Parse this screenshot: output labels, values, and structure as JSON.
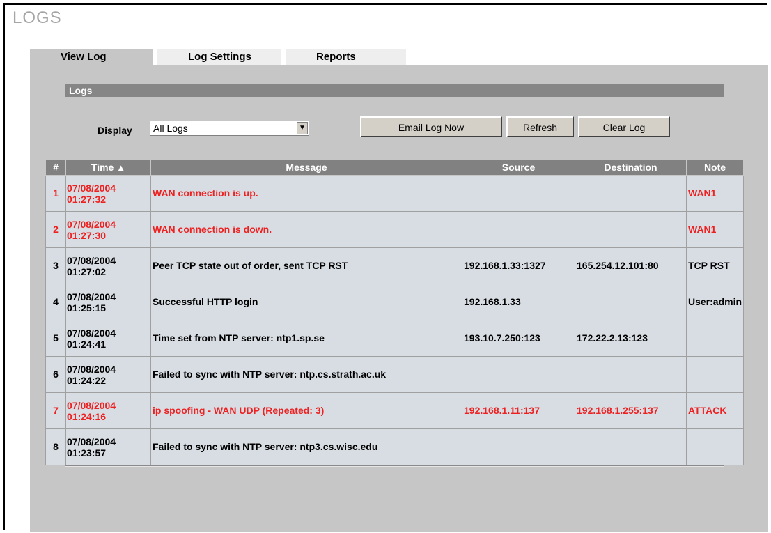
{
  "page_title": "LOGS",
  "tabs": [
    {
      "label": "View Log",
      "active": true
    },
    {
      "label": "Log Settings",
      "active": false
    },
    {
      "label": "Reports",
      "active": false
    }
  ],
  "section_title": "Logs",
  "display": {
    "label": "Display",
    "selected": "All Logs"
  },
  "buttons": {
    "email": "Email Log Now",
    "refresh": "Refresh",
    "clear": "Clear Log"
  },
  "table": {
    "columns": [
      "#",
      "Time",
      "Message",
      "Source",
      "Destination",
      "Note"
    ],
    "sort_arrow": "▲",
    "rows": [
      {
        "num": "1",
        "date": "07/08/2004",
        "time": "01:27:32",
        "message": "WAN connection is up.",
        "source": "",
        "destination": "",
        "note": "WAN1",
        "highlight": true
      },
      {
        "num": "2",
        "date": "07/08/2004",
        "time": "01:27:30",
        "message": "WAN connection is down.",
        "source": "",
        "destination": "",
        "note": "WAN1",
        "highlight": true
      },
      {
        "num": "3",
        "date": "07/08/2004",
        "time": "01:27:02",
        "message": "Peer TCP state out of order, sent TCP RST",
        "source": "192.168.1.33:1327",
        "destination": "165.254.12.101:80",
        "note": "TCP RST",
        "highlight": false
      },
      {
        "num": "4",
        "date": "07/08/2004",
        "time": "01:25:15",
        "message": "Successful HTTP login",
        "source": "192.168.1.33",
        "destination": "",
        "note": "User:admin",
        "highlight": false
      },
      {
        "num": "5",
        "date": "07/08/2004",
        "time": "01:24:41",
        "message": "Time set from NTP server: ntp1.sp.se",
        "source": "193.10.7.250:123",
        "destination": "172.22.2.13:123",
        "note": "",
        "highlight": false
      },
      {
        "num": "6",
        "date": "07/08/2004",
        "time": "01:24:22",
        "message": "Failed to sync with NTP server: ntp.cs.strath.ac.uk",
        "source": "",
        "destination": "",
        "note": "",
        "highlight": false
      },
      {
        "num": "7",
        "date": "07/08/2004",
        "time": "01:24:16",
        "message": "ip spoofing - WAN UDP (Repeated: 3)",
        "source": "192.168.1.11:137",
        "destination": "192.168.1.255:137",
        "note": "ATTACK",
        "highlight": true
      },
      {
        "num": "8",
        "date": "07/08/2004",
        "time": "01:23:57",
        "message": "Failed to sync with NTP server: ntp3.cs.wisc.edu",
        "source": "",
        "destination": "",
        "note": "",
        "highlight": false
      }
    ]
  },
  "colors": {
    "alert_text": "#ee2020",
    "header_bg": "#818181",
    "row_bg": "#d7dde3",
    "panel_bg": "#c6c6c6"
  }
}
